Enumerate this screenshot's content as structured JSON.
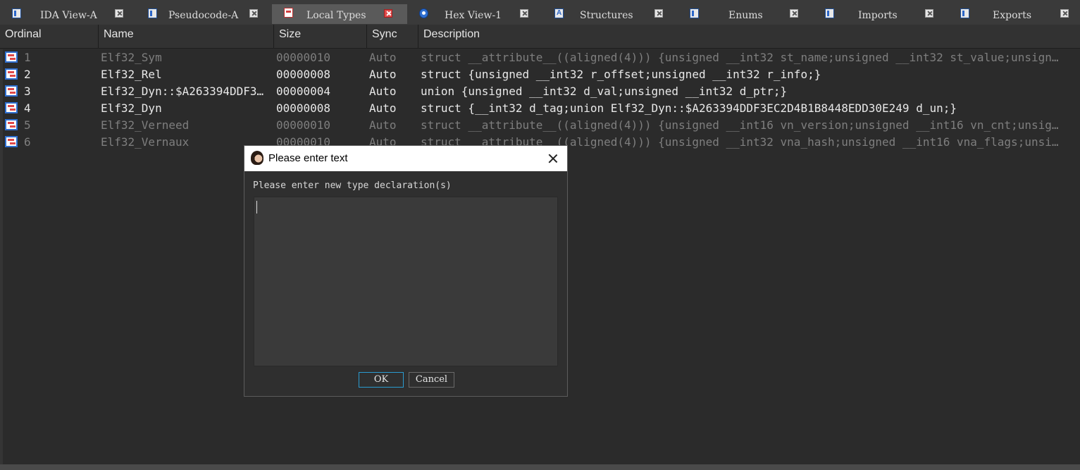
{
  "tabs": [
    {
      "label": "IDA View-A",
      "icon": "ida-view-icon",
      "active": false
    },
    {
      "label": "Pseudocode-A",
      "icon": "pseudocode-icon",
      "active": false
    },
    {
      "label": "Local Types",
      "icon": "local-types-icon",
      "active": true
    },
    {
      "label": "Hex View-1",
      "icon": "hex-view-icon",
      "active": false
    },
    {
      "label": "Structures",
      "icon": "structures-icon",
      "active": false
    },
    {
      "label": "Enums",
      "icon": "enums-icon",
      "active": false
    },
    {
      "label": "Imports",
      "icon": "imports-icon",
      "active": false
    },
    {
      "label": "Exports",
      "icon": "exports-icon",
      "active": false
    }
  ],
  "table": {
    "columns": [
      "Ordinal",
      "Name",
      "Size",
      "Sync",
      "Description"
    ],
    "rows": [
      {
        "ordinal": "1",
        "name": "Elf32_Sym",
        "size": "00000010",
        "sync": "Auto",
        "description": "struct __attribute__((aligned(4))) {unsigned __int32 st_name;unsigned __int32 st_value;unsign…",
        "dim": true
      },
      {
        "ordinal": "2",
        "name": "Elf32_Rel",
        "size": "00000008",
        "sync": "Auto",
        "description": "struct {unsigned __int32 r_offset;unsigned __int32 r_info;}",
        "dim": false
      },
      {
        "ordinal": "3",
        "name": "Elf32_Dyn::$A263394DDF3…",
        "size": "00000004",
        "sync": "Auto",
        "description": "union {unsigned __int32 d_val;unsigned __int32 d_ptr;}",
        "dim": false
      },
      {
        "ordinal": "4",
        "name": "Elf32_Dyn",
        "size": "00000008",
        "sync": "Auto",
        "description": "struct {__int32 d_tag;union Elf32_Dyn::$A263394DDF3EC2D4B1B8448EDD30E249 d_un;}",
        "dim": false
      },
      {
        "ordinal": "5",
        "name": "Elf32_Verneed",
        "size": "00000010",
        "sync": "Auto",
        "description": "struct __attribute__((aligned(4))) {unsigned __int16 vn_version;unsigned __int16 vn_cnt;unsig…",
        "dim": true
      },
      {
        "ordinal": "6",
        "name": "Elf32_Vernaux",
        "size": "00000010",
        "sync": "Auto",
        "description": "struct __attribute__((aligned(4))) {unsigned __int32 vna_hash;unsigned __int16 vna_flags;unsi…",
        "dim": true
      }
    ]
  },
  "dialog": {
    "title": "Please enter text",
    "prompt": "Please enter new type declaration(s)",
    "input_value": "",
    "ok_label": "OK",
    "cancel_label": "Cancel"
  },
  "colors": {
    "background": "#2b2b2b",
    "dim_text": "#7e7e7e",
    "bright_text": "#e8e8e8",
    "ok_border": "#2a9bd0",
    "active_close": "#e04a4a"
  }
}
